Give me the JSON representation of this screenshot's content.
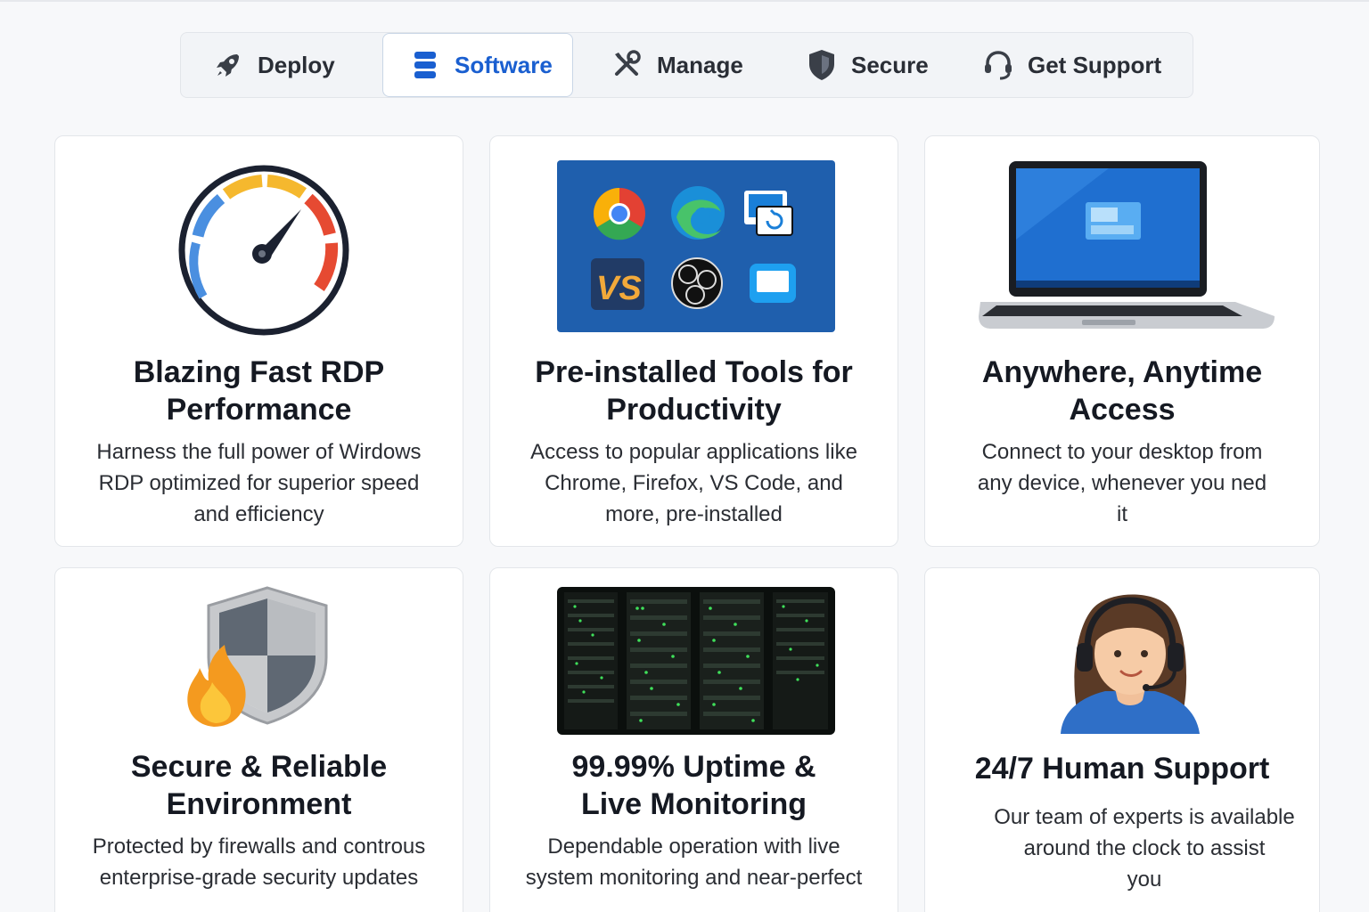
{
  "tabs": [
    {
      "label": "Deploy",
      "icon": "rocket-icon"
    },
    {
      "label": "Software",
      "icon": "database-icon",
      "active": true
    },
    {
      "label": "Manage",
      "icon": "tools-icon"
    },
    {
      "label": "Secure",
      "icon": "shield-icon"
    },
    {
      "label": "Get Support",
      "icon": "headset-icon"
    }
  ],
  "colors": {
    "accent": "#1a5fd0",
    "text": "#151922"
  },
  "cards": [
    {
      "title_line1": "Blazing Fast RDP",
      "title_line2": "Performance",
      "desc_line1": "Harness the full power of Wirdows",
      "desc_line2": "RDP optimized for superior speed",
      "desc_line3": "and efficiency",
      "image": "speedometer-icon"
    },
    {
      "title_line1": "Pre-installed Tools for",
      "title_line2": "Productivity",
      "desc_line1": "Access to popular applications like",
      "desc_line2": "Chrome, Firefox, VS Code, and",
      "desc_line3": "more, pre-installed",
      "image": "app-icons-grid"
    },
    {
      "title_line1": "Anywhere, Anytime",
      "title_line2": "Access",
      "desc_line1": "Connect to your desktop from",
      "desc_line2": "any device, whenever you ned",
      "desc_line3": "it",
      "image": "laptop-icon"
    },
    {
      "title_line1": "Secure & Reliable",
      "title_line2": "Environment",
      "desc_line1": "Protected by firewalls and controus",
      "desc_line2": "enterprise-grade security updates",
      "image": "shield-fire-icon"
    },
    {
      "title_line1": "99.99% Uptime &",
      "title_line2": "Live Monitoring",
      "desc_line1": "Dependable operation with live",
      "desc_line2": "system monitoring and near-perfect",
      "image": "server-rack-photo"
    },
    {
      "title_line1": "24/7 Human Support",
      "desc_line1": "Our team of experts is available",
      "desc_line2": "around the clock to assist",
      "desc_line3": "you",
      "image": "support-agent-icon"
    }
  ]
}
